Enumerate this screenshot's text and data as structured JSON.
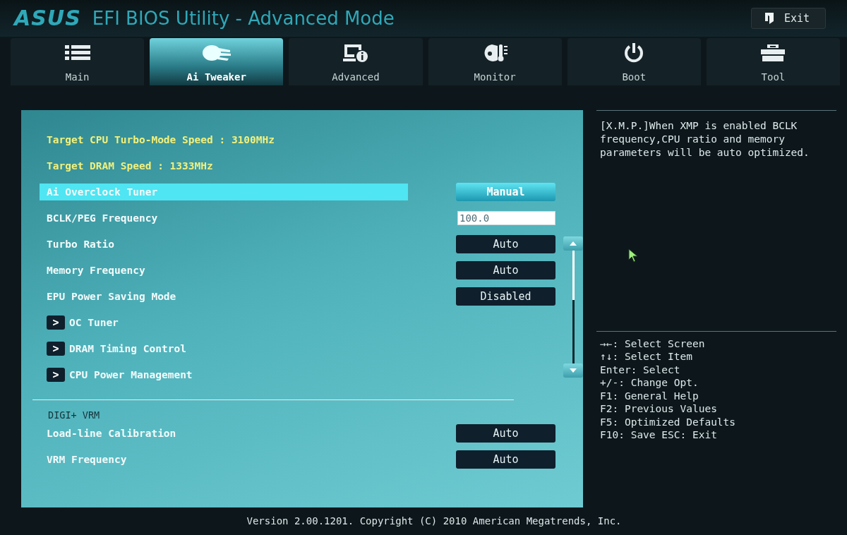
{
  "header": {
    "logo": "ASUS",
    "title": "EFI BIOS Utility - Advanced Mode",
    "exit_button": "Exit"
  },
  "tabs": [
    {
      "label": "Main",
      "selected": false
    },
    {
      "label": "Ai Tweaker",
      "selected": true
    },
    {
      "label": "Advanced",
      "selected": false
    },
    {
      "label": "Monitor",
      "selected": false
    },
    {
      "label": "Boot",
      "selected": false
    },
    {
      "label": "Tool",
      "selected": false
    }
  ],
  "info_lines": [
    "Target CPU Turbo-Mode Speed : 3100MHz",
    "Target DRAM Speed : 1333MHz"
  ],
  "settings": [
    {
      "kind": "dropdown",
      "label": "Ai Overclock Tuner",
      "value": "Manual",
      "selected": true
    },
    {
      "kind": "input",
      "label": "BCLK/PEG Frequency",
      "value": "100.0",
      "selected": false
    },
    {
      "kind": "dropdown",
      "label": "Turbo Ratio",
      "value": "Auto",
      "selected": false
    },
    {
      "kind": "dropdown",
      "label": "Memory Frequency",
      "value": "Auto",
      "selected": false
    },
    {
      "kind": "dropdown",
      "label": "EPU Power Saving Mode",
      "value": "Disabled",
      "selected": false
    },
    {
      "kind": "submenu",
      "label": "OC Tuner",
      "value": ">",
      "selected": false
    },
    {
      "kind": "submenu",
      "label": "DRAM Timing Control",
      "value": ">",
      "selected": false
    },
    {
      "kind": "submenu",
      "label": "CPU Power Management",
      "value": ">",
      "selected": false
    },
    {
      "kind": "divider"
    },
    {
      "kind": "heading",
      "label": "DIGI+ VRM"
    },
    {
      "kind": "dropdown",
      "label": "Load-line Calibration",
      "value": "Auto",
      "selected": false
    },
    {
      "kind": "dropdown",
      "label": "VRM Frequency",
      "value": "Auto",
      "selected": false
    }
  ],
  "help_text": "[X.M.P.]When XMP is enabled BCLK frequency,CPU ratio and memory parameters will be auto optimized.",
  "hotkeys": [
    "→←: Select Screen",
    "↑↓: Select Item",
    "Enter: Select",
    "+/-: Change Opt.",
    "F1: General Help",
    "F2: Previous Values",
    "F5: Optimized Defaults",
    "F10: Save  ESC: Exit"
  ],
  "footer": "Version 2.00.1201. Copyright (C) 2010 American Megatrends, Inc."
}
